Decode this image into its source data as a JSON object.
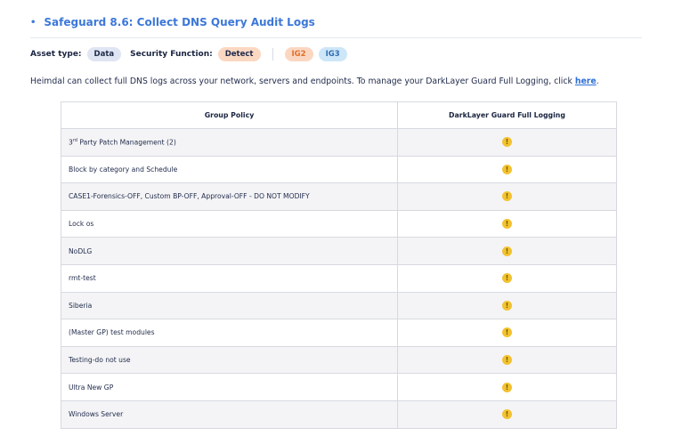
{
  "section": {
    "bullet": "•",
    "title": "Safeguard 8.6: Collect DNS Query Audit Logs"
  },
  "meta": {
    "asset_type_label": "Asset type:",
    "asset_type_value": "Data",
    "security_function_label": "Security Function:",
    "security_function_value": "Detect",
    "tags": [
      "IG2",
      "IG3"
    ]
  },
  "intro": {
    "text": "Heimdal can collect full DNS logs across your network, servers and endpoints. To manage your DarkLayer Guard Full Logging, click ",
    "link": "here",
    "suffix": "."
  },
  "table": {
    "headers": [
      "Group Policy",
      "DarkLayer Guard Full Logging"
    ],
    "status_icon": "warning-circle-icon",
    "status_color": "#f2c230",
    "rows": [
      {
        "name": "3rd Party Patch Management (2)",
        "status": "!"
      },
      {
        "name": "Block by category and Schedule",
        "status": "!"
      },
      {
        "name": "CASE1-Forensics-OFF, Custom BP-OFF, Approval-OFF - DO NOT MODIFY",
        "status": "!"
      },
      {
        "name": "Lock os",
        "status": "!"
      },
      {
        "name": "NoDLG",
        "status": "!"
      },
      {
        "name": "rmt-test",
        "status": "!"
      },
      {
        "name": "Siberia",
        "status": "!"
      },
      {
        "name": "(Master GP) test modules",
        "status": "!"
      },
      {
        "name": "Testing-do not use",
        "status": "!"
      },
      {
        "name": "Ultra New GP",
        "status": "!"
      },
      {
        "name": "Windows Server",
        "status": "!"
      }
    ]
  }
}
